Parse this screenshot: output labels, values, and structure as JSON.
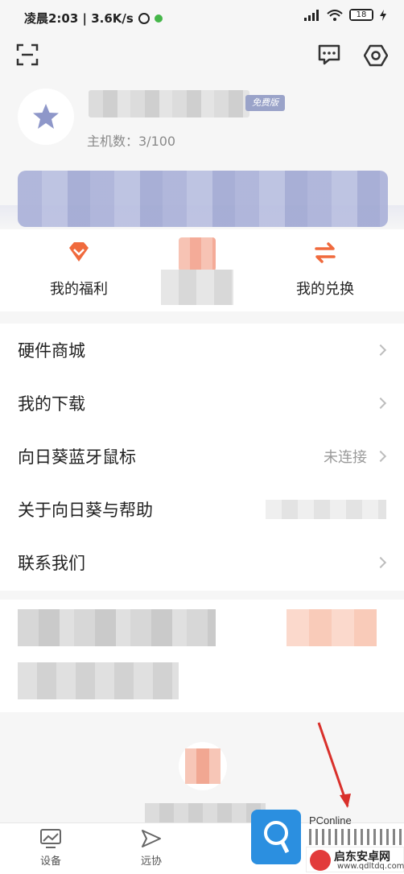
{
  "status_bar": {
    "time_speed": "凌晨2:03 | 3.6K/s",
    "battery": "18"
  },
  "header": {
    "scan_icon": "scan-icon",
    "message_icon": "message-icon",
    "settings_icon": "gear-icon"
  },
  "profile": {
    "badge": "免费版",
    "host_count": "主机数：3/100"
  },
  "quick_actions": [
    {
      "label": "我的福利",
      "icon": "diamond-icon",
      "color": "#f06a3d"
    },
    {
      "label": "我的兑换",
      "icon": "exchange-icon",
      "color": "#f06a3d"
    }
  ],
  "menu": {
    "items": [
      {
        "label": "硬件商城"
      },
      {
        "label": "我的下载"
      },
      {
        "label": "向日葵蓝牙鼠标",
        "status": "未连接"
      },
      {
        "label": "关于向日葵与帮助"
      },
      {
        "label": "联系我们"
      }
    ]
  },
  "tab_bar": {
    "tabs": [
      {
        "label": "设备",
        "icon": "devices-icon"
      },
      {
        "label": "远协",
        "icon": "remote-assist-icon"
      }
    ]
  },
  "watermark": {
    "pconline": "PConline",
    "site_title": "启东安卓网",
    "site_url": "www.qdltdq.com"
  },
  "colors": {
    "accent": "#f06a3d",
    "badge": "#9aa3c9",
    "annotation_arrow": "#d9302b"
  }
}
